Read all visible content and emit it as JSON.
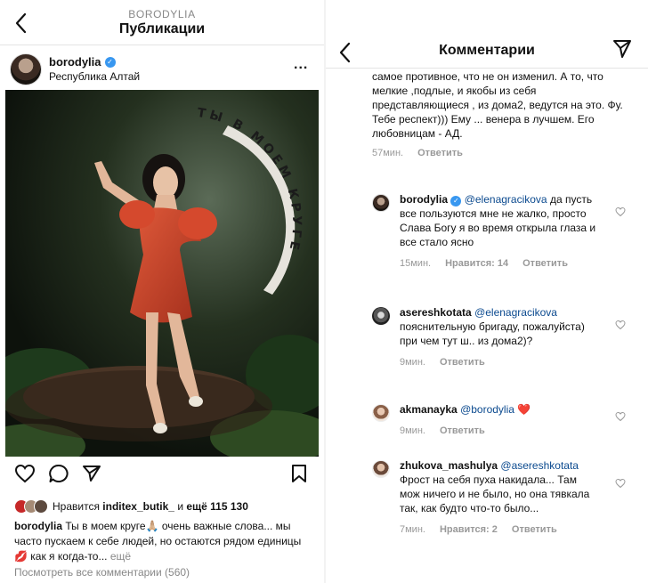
{
  "left": {
    "header_user": "BORODYLIA",
    "header_title": "Публикации",
    "post": {
      "username": "borodylia",
      "location": "Республика Алтай",
      "more_icon": "...",
      "photo_text": "ТЫ В МОЕМ КРУГЕ",
      "likes_prefix": "Нравится ",
      "likes_user": "inditex_butik_",
      "likes_mid": " и ",
      "likes_count": "ещё 115 130",
      "caption_user": "borodylia",
      "caption_text": " Ты в моем круге🙏🏼 очень важные слова... мы часто  пускаем к себе людей, но остаются рядом единицы💋  как я когда-то...",
      "caption_more": " ещё",
      "view_all": "Посмотреть все комментарии (560)"
    }
  },
  "right": {
    "title": "Комментарии",
    "top_comment": {
      "text": "самое противное, что не он изменил. А то, что мелкие ,подлые, и якобы из себя представляющиеся         , из дома2, ведутся на это. Фу. Тебе респект))) Ему ... венера  в лучшем. Его любовницам - АД.",
      "time": "57мин.",
      "reply": "Ответить"
    },
    "comments": [
      {
        "user": "borodylia",
        "verified": true,
        "mention": "@elenagracikova",
        "text": " да пусть все пользуются мне не жалко, просто Слава Богу я во время открыла глаза и все стало ясно",
        "time": "15мин.",
        "likes": "Нравится: 14",
        "reply": "Ответить"
      },
      {
        "user": "asereshkotata",
        "mention": "@elenagracikova",
        "text": " пояснительную бригаду, пожалуйста) при чем тут ш.. из дома2)?",
        "time": "9мин.",
        "reply": "Ответить"
      },
      {
        "user": "akmanayka",
        "mention": "@borodylia",
        "text": " ❤️",
        "time": "9мин.",
        "reply": "Ответить"
      },
      {
        "user": "zhukova_mashulya",
        "mention": "@asereshkotata",
        "text": " Фрост на себя пуха накидала... Там мож ничего и не было, но она тявкала так, как будто что-то было...",
        "time": "7мин.",
        "likes": "Нравится: 2",
        "reply": "Ответить"
      }
    ]
  },
  "colors": {
    "mention": "#0b4a8f",
    "verified": "#3897f0",
    "meta_gray": "#999999"
  }
}
